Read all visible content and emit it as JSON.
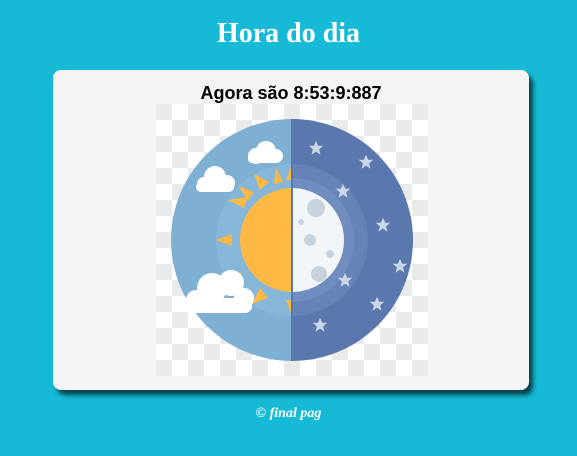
{
  "header": {
    "title": "Hora do dia"
  },
  "clock": {
    "text": "Agora são 8:53:9:887"
  },
  "illustration": {
    "icon": "day-night-icon",
    "colors": {
      "day_sky": "#7db0d2",
      "night_sky": "#5a78ad",
      "sun": "#fdb943",
      "moon": "#f2f5f7",
      "cloud": "#ffffff",
      "star": "#c9d6e6"
    }
  },
  "footer": {
    "text": "© final pag"
  },
  "theme": {
    "background": "#16bad6",
    "card": "#f5f3f4"
  }
}
